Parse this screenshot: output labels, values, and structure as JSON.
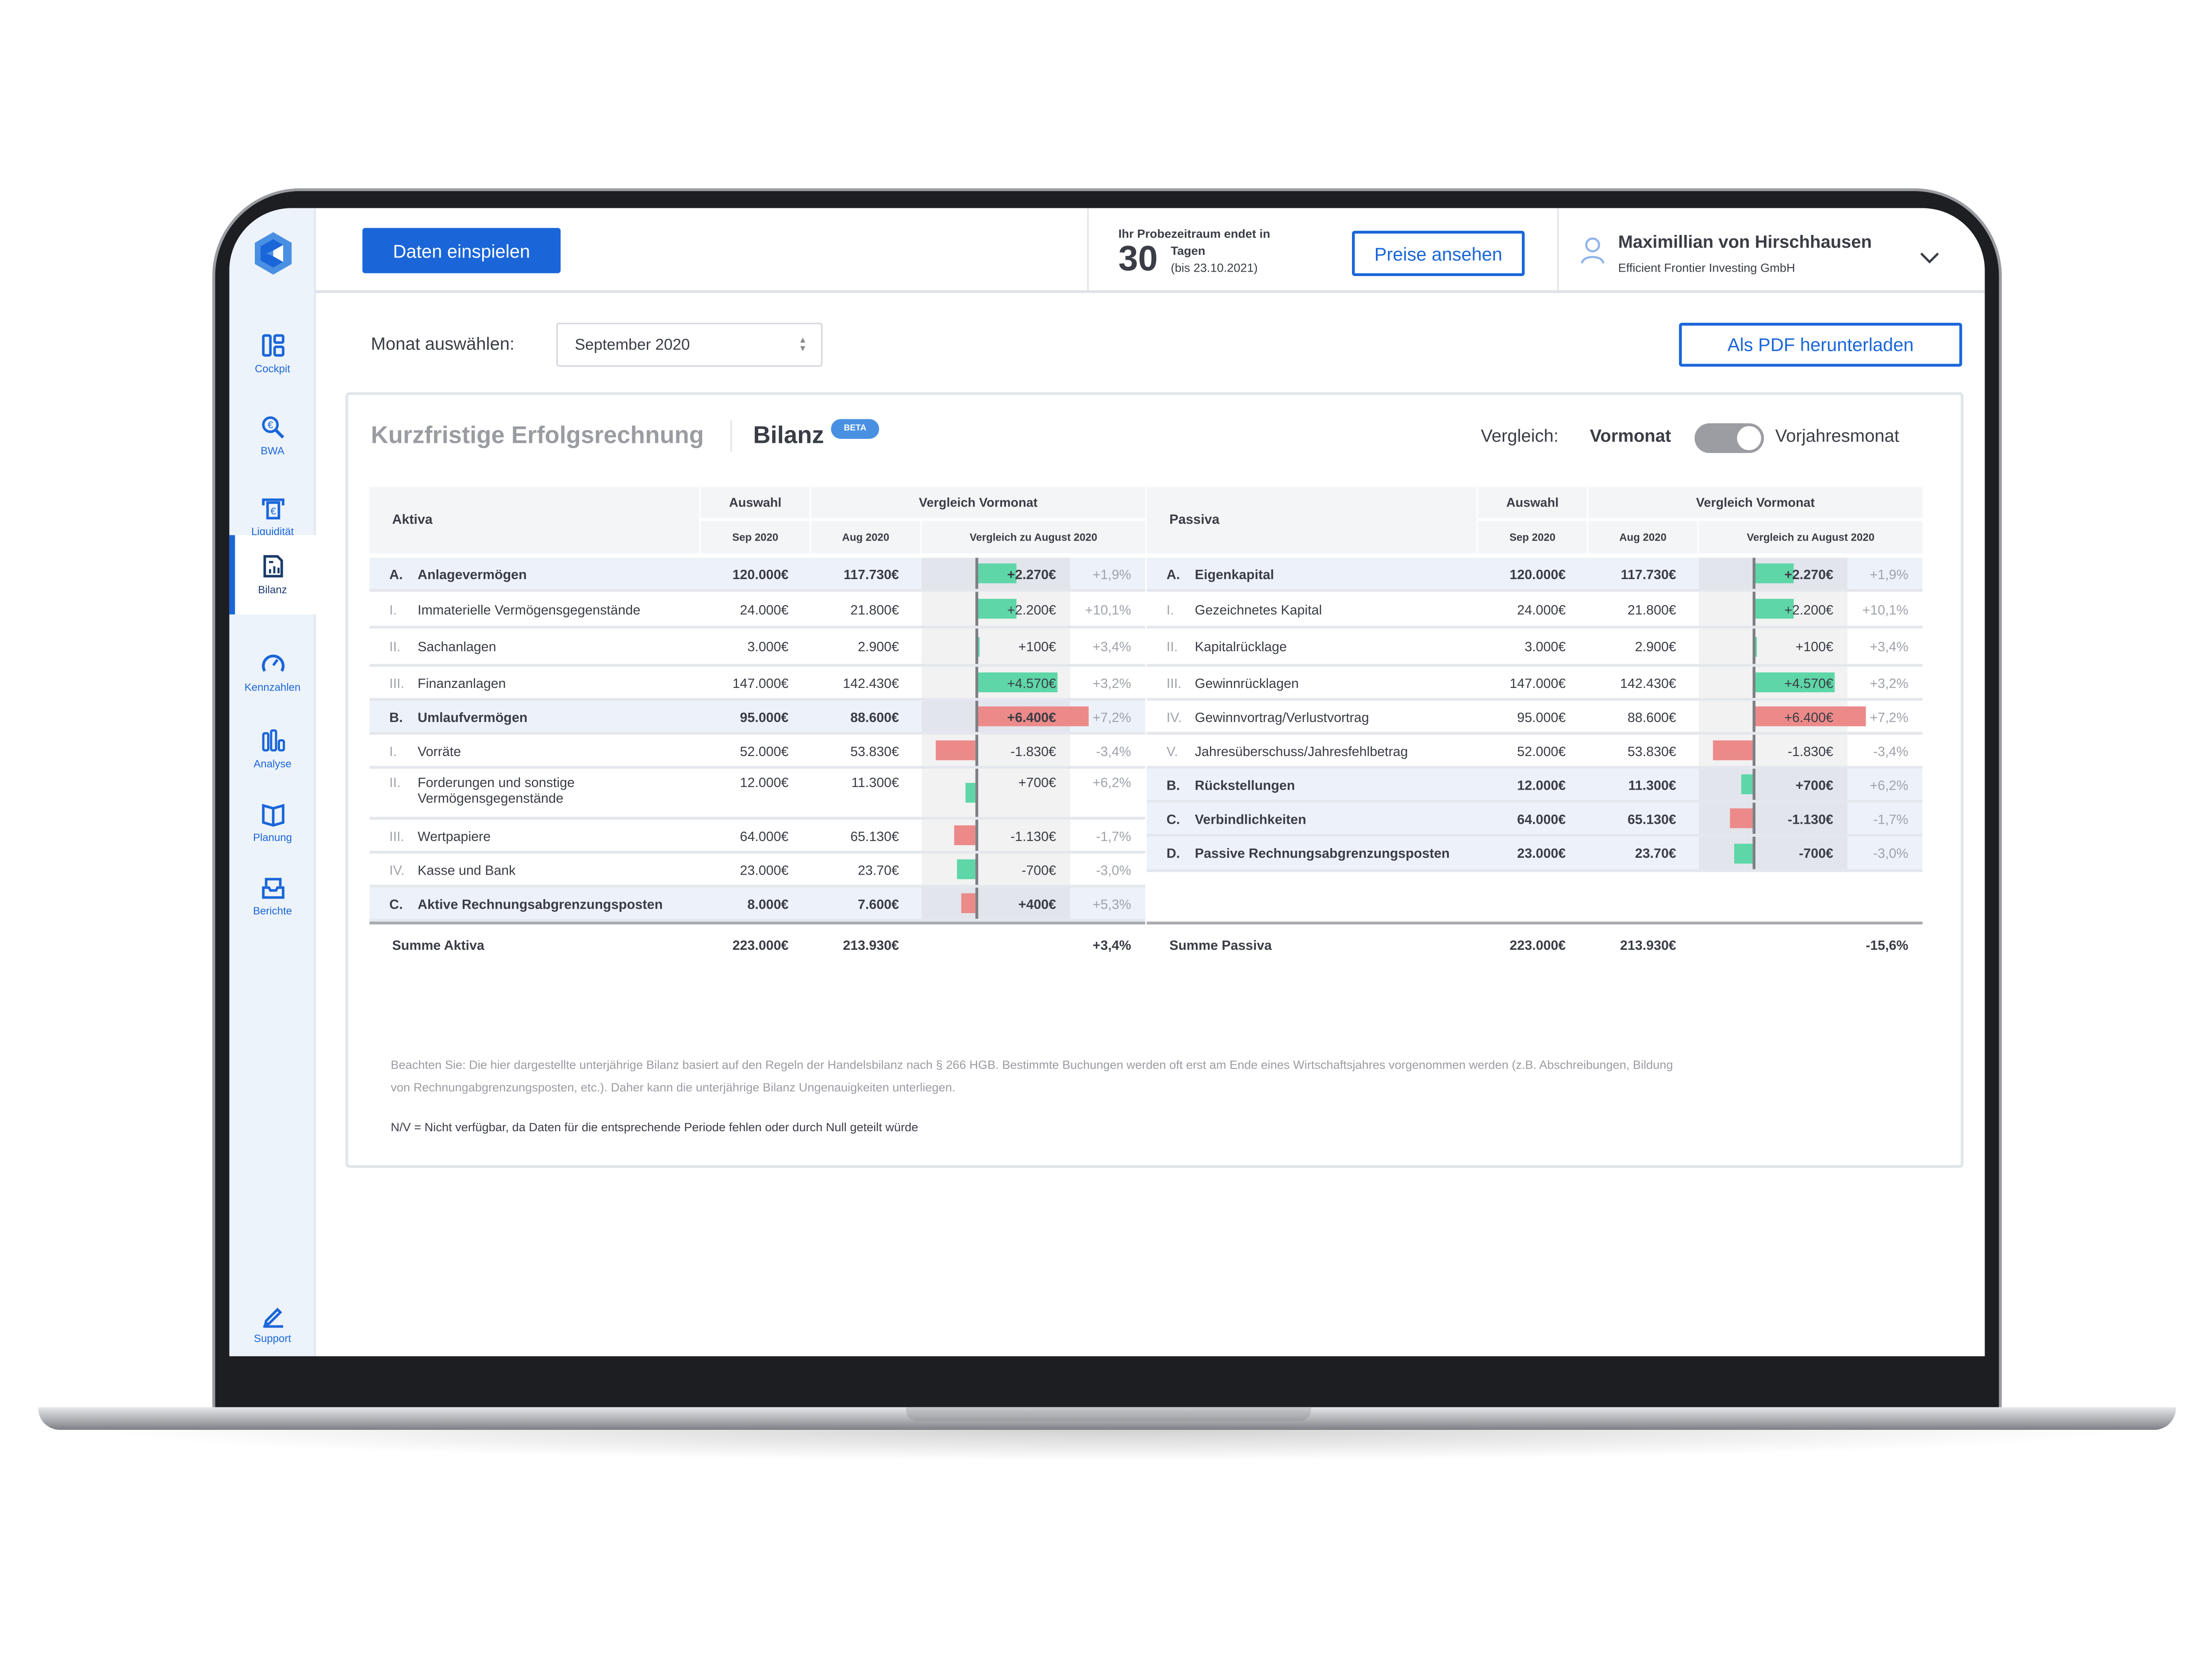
{
  "colors": {
    "accent": "#1a66d9",
    "positive_bar": "#5ed6a8",
    "negative_bar": "#ec8a8a",
    "group_row": "#edf2fa"
  },
  "sidebar": {
    "logo_icon": "hexagon-logo-icon",
    "items": [
      {
        "label": "Cockpit",
        "icon": "dashboard-icon",
        "active": false
      },
      {
        "label": "BWA",
        "icon": "euro-magnifier-icon",
        "active": false
      },
      {
        "label": "Liquidität",
        "icon": "euro-atm-icon",
        "active": false
      },
      {
        "label": "Bilanz",
        "icon": "report-chart-icon",
        "active": true
      },
      {
        "label": "Kennzahlen",
        "icon": "gauge-icon",
        "active": false
      },
      {
        "label": "Analyse",
        "icon": "bar-chart-icon",
        "active": false
      },
      {
        "label": "Planung",
        "icon": "book-icon",
        "active": false
      },
      {
        "label": "Berichte",
        "icon": "inbox-tray-icon",
        "active": false
      }
    ],
    "support": {
      "label": "Support",
      "icon": "pencil-icon"
    }
  },
  "header": {
    "import_button": "Daten einspielen",
    "trial_label": "Ihr Probezeitraum endet in",
    "trial_days": "30",
    "trial_unit": "Tagen",
    "trial_until": "(bis 23.10.2021)",
    "prices_button": "Preise ansehen",
    "user_name": "Maximillian von Hirschhausen",
    "company": "Efficient Frontier Investing GmbH"
  },
  "toolbar": {
    "month_label": "Monat auswählen:",
    "month_value": "September 2020",
    "pdf_button": "Als PDF herunterladen"
  },
  "card": {
    "tab_inactive": "Kurzfristige Erfolgsrechnung",
    "tab_active": "Bilanz",
    "beta_badge": "BETA",
    "compare_label": "Vergleich:",
    "compare_option_a": "Vormonat",
    "compare_option_b": "Vorjahresmonat",
    "toggle_state": "Vormonat"
  },
  "tables": [
    {
      "title": "Aktiva",
      "h_auswahl": "Auswahl",
      "h_vergleich": "Vergleich Vormonat",
      "h_sep": "Sep 2020",
      "h_aug": "Aug 2020",
      "h_cmp": "Vergleich zu August 2020",
      "rows": [
        {
          "num": "A.",
          "label": "Anlagevermögen",
          "group": true,
          "sep": "120.000€",
          "aug": "117.730€",
          "diff": "+2.270€",
          "pct": "+1,9%",
          "bar_value": 2270,
          "bar_color": "green"
        },
        {
          "num": "I.",
          "label": "Immaterielle Vermögensgegenstände",
          "group": false,
          "sep": "24.000€",
          "aug": "21.800€",
          "diff": "+2.200€",
          "pct": "+10,1%",
          "bar_value": 2270,
          "bar_color": "green"
        },
        {
          "num": "II.",
          "label": "Sachanlagen",
          "group": false,
          "sep": "3.000€",
          "aug": "2.900€",
          "diff": "+100€",
          "pct": "+3,4%",
          "bar_value": 150,
          "bar_color": "green"
        },
        {
          "num": "III.",
          "label": "Finanzanlagen",
          "group": false,
          "sep": "147.000€",
          "aug": "142.430€",
          "diff": "+4.570€",
          "pct": "+3,2%",
          "bar_value": 4570,
          "bar_color": "green"
        },
        {
          "num": "B.",
          "label": "Umlaufvermögen",
          "group": true,
          "sep": "95.000€",
          "aug": "88.600€",
          "diff": "+6.400€",
          "pct": "+7,2%",
          "bar_value": 6400,
          "bar_color": "red"
        },
        {
          "num": "I.",
          "label": "Vorräte",
          "group": false,
          "sep": "52.000€",
          "aug": "53.830€",
          "diff": "-1.830€",
          "pct": "-3,4%",
          "bar_value": -2270,
          "bar_color": "red"
        },
        {
          "num": "II.",
          "label": "Forderungen und sonstige Vermögensgegenstände",
          "group": false,
          "sep": "12.000€",
          "aug": "11.300€",
          "diff": "+700€",
          "pct": "+6,2%",
          "bar_value": -500,
          "bar_color": "green"
        },
        {
          "num": "III.",
          "label": "Wertpapiere",
          "group": false,
          "sep": "64.000€",
          "aug": "65.130€",
          "diff": "-1.130€",
          "pct": "-1,7%",
          "bar_value": -1250,
          "bar_color": "red"
        },
        {
          "num": "IV.",
          "label": "Kasse und Bank",
          "group": false,
          "sep": "23.000€",
          "aug": "23.70€",
          "diff": "-700€",
          "pct": "-3,0%",
          "bar_value": -850,
          "bar_color": "green"
        },
        {
          "num": "C.",
          "label": "Aktive Rechnungsabgrenzungsposten",
          "group": true,
          "sep": "8.000€",
          "aug": "7.600€",
          "diff": "+400€",
          "pct": "+5,3%",
          "bar_value": -700,
          "bar_color": "red"
        }
      ],
      "sum": {
        "label": "Summe Aktiva",
        "sep": "223.000€",
        "aug": "213.930€",
        "pct": "+3,4%"
      }
    },
    {
      "title": "Passiva",
      "h_auswahl": "Auswahl",
      "h_vergleich": "Vergleich Vormonat",
      "h_sep": "Sep 2020",
      "h_aug": "Aug 2020",
      "h_cmp": "Vergleich zu August 2020",
      "rows": [
        {
          "num": "A.",
          "label": "Eigenkapital",
          "group": true,
          "sep": "120.000€",
          "aug": "117.730€",
          "diff": "+2.270€",
          "pct": "+1,9%",
          "bar_value": 2270,
          "bar_color": "green"
        },
        {
          "num": "I.",
          "label": "Gezeichnetes Kapital",
          "group": false,
          "sep": "24.000€",
          "aug": "21.800€",
          "diff": "+2.200€",
          "pct": "+10,1%",
          "bar_value": 2270,
          "bar_color": "green"
        },
        {
          "num": "II.",
          "label": "Kapitalrücklage",
          "group": false,
          "sep": "3.000€",
          "aug": "2.900€",
          "diff": "+100€",
          "pct": "+3,4%",
          "bar_value": 150,
          "bar_color": "green"
        },
        {
          "num": "III.",
          "label": "Gewinnrücklagen",
          "group": false,
          "sep": "147.000€",
          "aug": "142.430€",
          "diff": "+4.570€",
          "pct": "+3,2%",
          "bar_value": 4570,
          "bar_color": "green"
        },
        {
          "num": "IV.",
          "label": "Gewinnvortrag/Verlustvortrag",
          "group": false,
          "sep": "95.000€",
          "aug": "88.600€",
          "diff": "+6.400€",
          "pct": "+7,2%",
          "bar_value": 6400,
          "bar_color": "red"
        },
        {
          "num": "V.",
          "label": "Jahresüberschuss/Jahresfehlbetrag",
          "group": false,
          "sep": "52.000€",
          "aug": "53.830€",
          "diff": "-1.830€",
          "pct": "-3,4%",
          "bar_value": -2270,
          "bar_color": "red"
        },
        {
          "num": "B.",
          "label": "Rückstellungen",
          "group": true,
          "sep": "12.000€",
          "aug": "11.300€",
          "diff": "+700€",
          "pct": "+6,2%",
          "bar_value": -550,
          "bar_color": "green"
        },
        {
          "num": "C.",
          "label": "Verbindlichkeiten",
          "group": true,
          "sep": "64.000€",
          "aug": "65.130€",
          "diff": "-1.130€",
          "pct": "-1,7%",
          "bar_value": -1300,
          "bar_color": "red"
        },
        {
          "num": "D.",
          "label": "Passive Rechnungsabgrenzungsposten",
          "group": true,
          "sep": "23.000€",
          "aug": "23.70€",
          "diff": "-700€",
          "pct": "-3,0%",
          "bar_value": -900,
          "bar_color": "green"
        }
      ],
      "sum": {
        "label": "Summe Passiva",
        "sep": "223.000€",
        "aug": "213.930€",
        "pct": "-15,6%"
      }
    }
  ],
  "notes": {
    "disclaimer": "Beachten Sie: Die hier dargestellte unterjährige Bilanz basiert auf den Regeln der Handelsbilanz nach § 266 HGB. Bestimmte Buchungen werden oft erst am Ende eines Wirtschaftsjahres vorgenommen werden (z.B. Abschreibungen, Bildung von Rechnungabgrenzungsposten, etc.). Daher kann die unterjährige Bilanz Ungenauigkeiten unterliegen.",
    "na_note": "N/V = Nicht verfügbar, da Daten für die entsprechende Periode fehlen oder durch Null geteilt würde"
  }
}
